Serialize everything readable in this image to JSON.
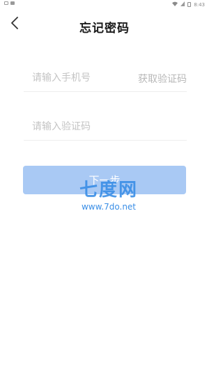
{
  "status": {
    "time": "8:43",
    "wifi_icon": "wifi-icon",
    "signal_icon": "signal-icon",
    "battery_icon": "battery-icon"
  },
  "header": {
    "title": "忘记密码",
    "back_icon": "chevron-left-icon"
  },
  "form": {
    "phone_placeholder": "请输入手机号",
    "get_code_label": "获取验证码",
    "code_placeholder": "请输入验证码"
  },
  "actions": {
    "next_label": "下一步"
  },
  "watermark": {
    "logo": "七度网",
    "url": "www.7do.net"
  },
  "colors": {
    "primary_button": "#a9c9f4",
    "watermark": "#3a8ee6"
  }
}
